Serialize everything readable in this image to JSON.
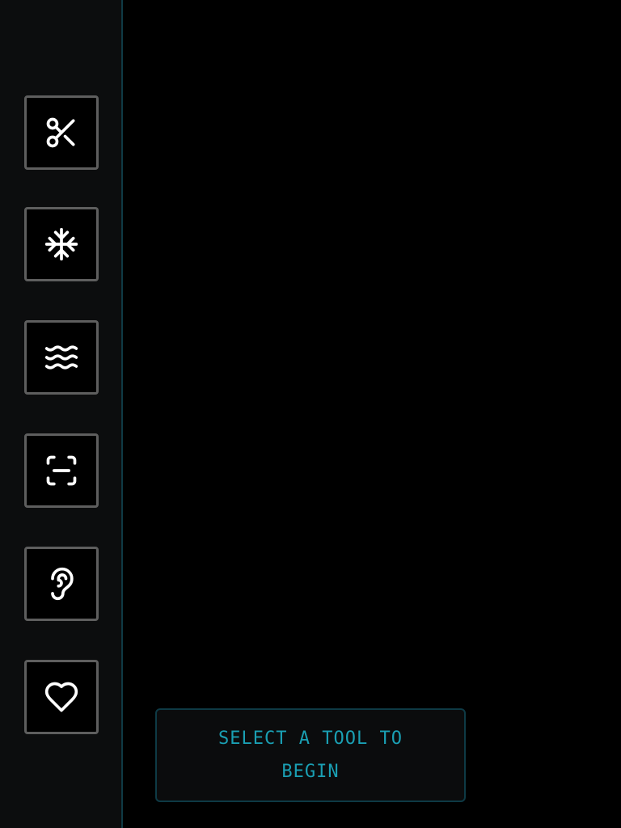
{
  "tools": [
    {
      "id": "cut",
      "icon": "scissors-icon"
    },
    {
      "id": "freeze",
      "icon": "snowflake-icon"
    },
    {
      "id": "waves",
      "icon": "waves-icon"
    },
    {
      "id": "scan",
      "icon": "scan-icon"
    },
    {
      "id": "listen",
      "icon": "ear-icon"
    },
    {
      "id": "love",
      "icon": "heart-icon"
    }
  ],
  "hint": {
    "text": "SELECT A TOOL TO BEGIN"
  },
  "colors": {
    "accent": "#1a9fb3",
    "icon": "#ffffff",
    "tool_border": "#5e5e5e",
    "sidebar_bg": "#0c0d0e",
    "divider": "#0f3a44"
  }
}
